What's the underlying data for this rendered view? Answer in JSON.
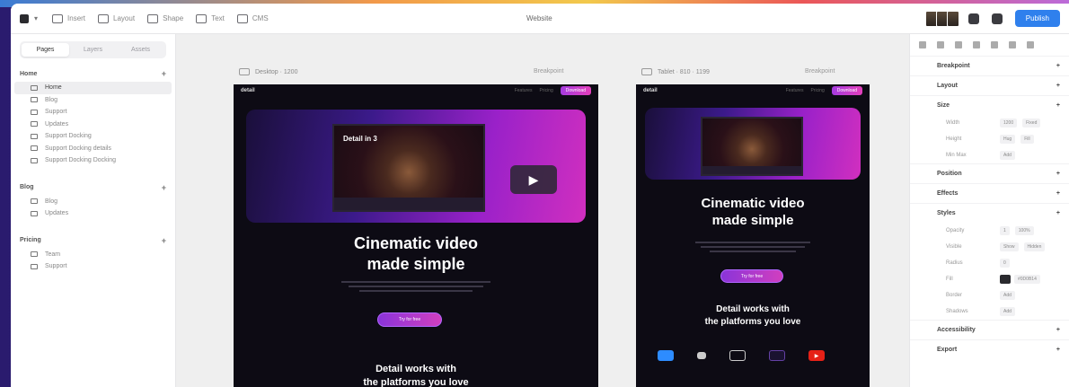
{
  "toolbar": {
    "items": [
      {
        "label": "Insert"
      },
      {
        "label": "Layout"
      },
      {
        "label": "Shape"
      },
      {
        "label": "Text"
      },
      {
        "label": "CMS"
      }
    ],
    "title": "Website",
    "publish_label": "Publish"
  },
  "left_panel": {
    "tabs": [
      "Pages",
      "Layers",
      "Assets"
    ],
    "sections": [
      {
        "title": "Home",
        "items": [
          "Home",
          "Blog",
          "Support",
          "Updates",
          "Support Docking",
          "Support Docking details",
          "Support Docking Docking"
        ],
        "selected": 0
      },
      {
        "title": "Blog",
        "items": [
          "Blog",
          "Updates"
        ]
      },
      {
        "title": "Pricing",
        "items": [
          "Team",
          "Support"
        ]
      }
    ]
  },
  "canvas": {
    "desktop_frame": {
      "label": "Desktop · 1200",
      "breakpoint": "Breakpoint",
      "logo": "detail",
      "nav_links": [
        "Features",
        "Pricing"
      ],
      "nav_cta": "Download",
      "video_title": "Detail in 3",
      "play_icon": "play-icon",
      "hero_title_line1": "Cinematic video",
      "hero_title_line2": "made simple",
      "cta_label": "Try for free",
      "section_title_line1": "Detail works with",
      "section_title_line2": "the platforms you love"
    },
    "tablet_frame": {
      "label": "Tablet · 810 · 1199",
      "breakpoint": "Breakpoint",
      "logo": "detail",
      "nav_links": [
        "Features",
        "Pricing"
      ],
      "nav_cta": "Download",
      "hero_title_line1": "Cinematic video",
      "hero_title_line2": "made simple",
      "cta_label": "Try for free",
      "section_title_line1": "Detail works with",
      "section_title_line2": "the platforms you love",
      "platforms": [
        {
          "name": "zoom",
          "color": "#2d8cff"
        },
        {
          "name": "meet",
          "color": "#cccccc"
        },
        {
          "name": "obs",
          "color": "#222222"
        },
        {
          "name": "twitch",
          "color": "#6441a5"
        },
        {
          "name": "youtube",
          "color": "#e62117"
        }
      ]
    }
  },
  "right_panel": {
    "sections": [
      {
        "title": "Breakpoint"
      },
      {
        "title": "Layout"
      },
      {
        "title": "Size",
        "rows": [
          {
            "label": "Width",
            "v1": "1200",
            "v2": "Fixed"
          },
          {
            "label": "Height",
            "v1": "Hug",
            "v2": "Fill"
          },
          {
            "label": "Min Max",
            "v1": "Add"
          }
        ]
      },
      {
        "title": "Position"
      },
      {
        "title": "Effects"
      },
      {
        "title": "Styles",
        "rows": [
          {
            "label": "Opacity",
            "v1": "1",
            "v2": "100%"
          },
          {
            "label": "Visible",
            "v1": "Show",
            "v2": "Hidden"
          },
          {
            "label": "Radius",
            "v1": "0"
          },
          {
            "label": "Fill",
            "v1": "#0D0B14"
          },
          {
            "label": "Border",
            "v1": "Add"
          },
          {
            "label": "Shadows",
            "v1": "Add"
          }
        ]
      },
      {
        "title": "Accessibility"
      },
      {
        "title": "Export"
      }
    ]
  },
  "colors": {
    "accent": "#2f80ed",
    "frame_bg": "#0d0b14",
    "hero_purple": "#9a21c9",
    "hero_pink": "#d12fbf"
  }
}
